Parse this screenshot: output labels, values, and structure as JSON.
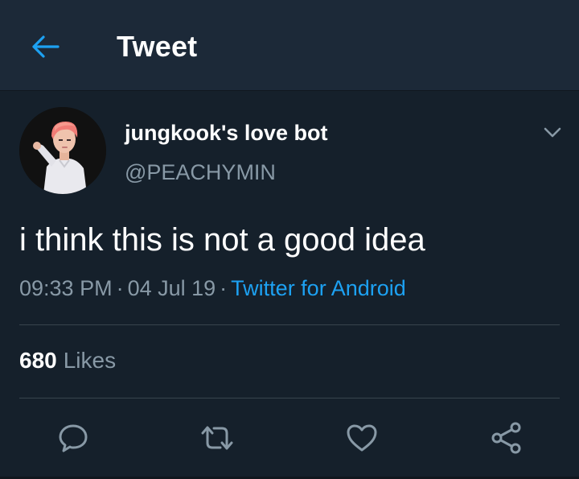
{
  "header": {
    "title": "Tweet",
    "back_icon": "arrow-left-icon"
  },
  "tweet": {
    "display_name": "jungkook's love bot",
    "handle": "@PEACHYMIN",
    "text": "i think this is not a good idea",
    "time": "09:33 PM",
    "date": "04 Jul 19",
    "source": "Twitter for Android",
    "separator": "·",
    "likes_count": "680",
    "likes_label": "Likes"
  },
  "actions": [
    {
      "name": "reply",
      "icon": "reply-icon"
    },
    {
      "name": "retweet",
      "icon": "retweet-icon"
    },
    {
      "name": "like",
      "icon": "heart-icon"
    },
    {
      "name": "share",
      "icon": "share-icon"
    }
  ],
  "colors": {
    "background": "#15202b",
    "header_background": "#1c2938",
    "accent": "#1da1f2",
    "secondary_text": "#8899a6",
    "divider": "#38444d"
  }
}
